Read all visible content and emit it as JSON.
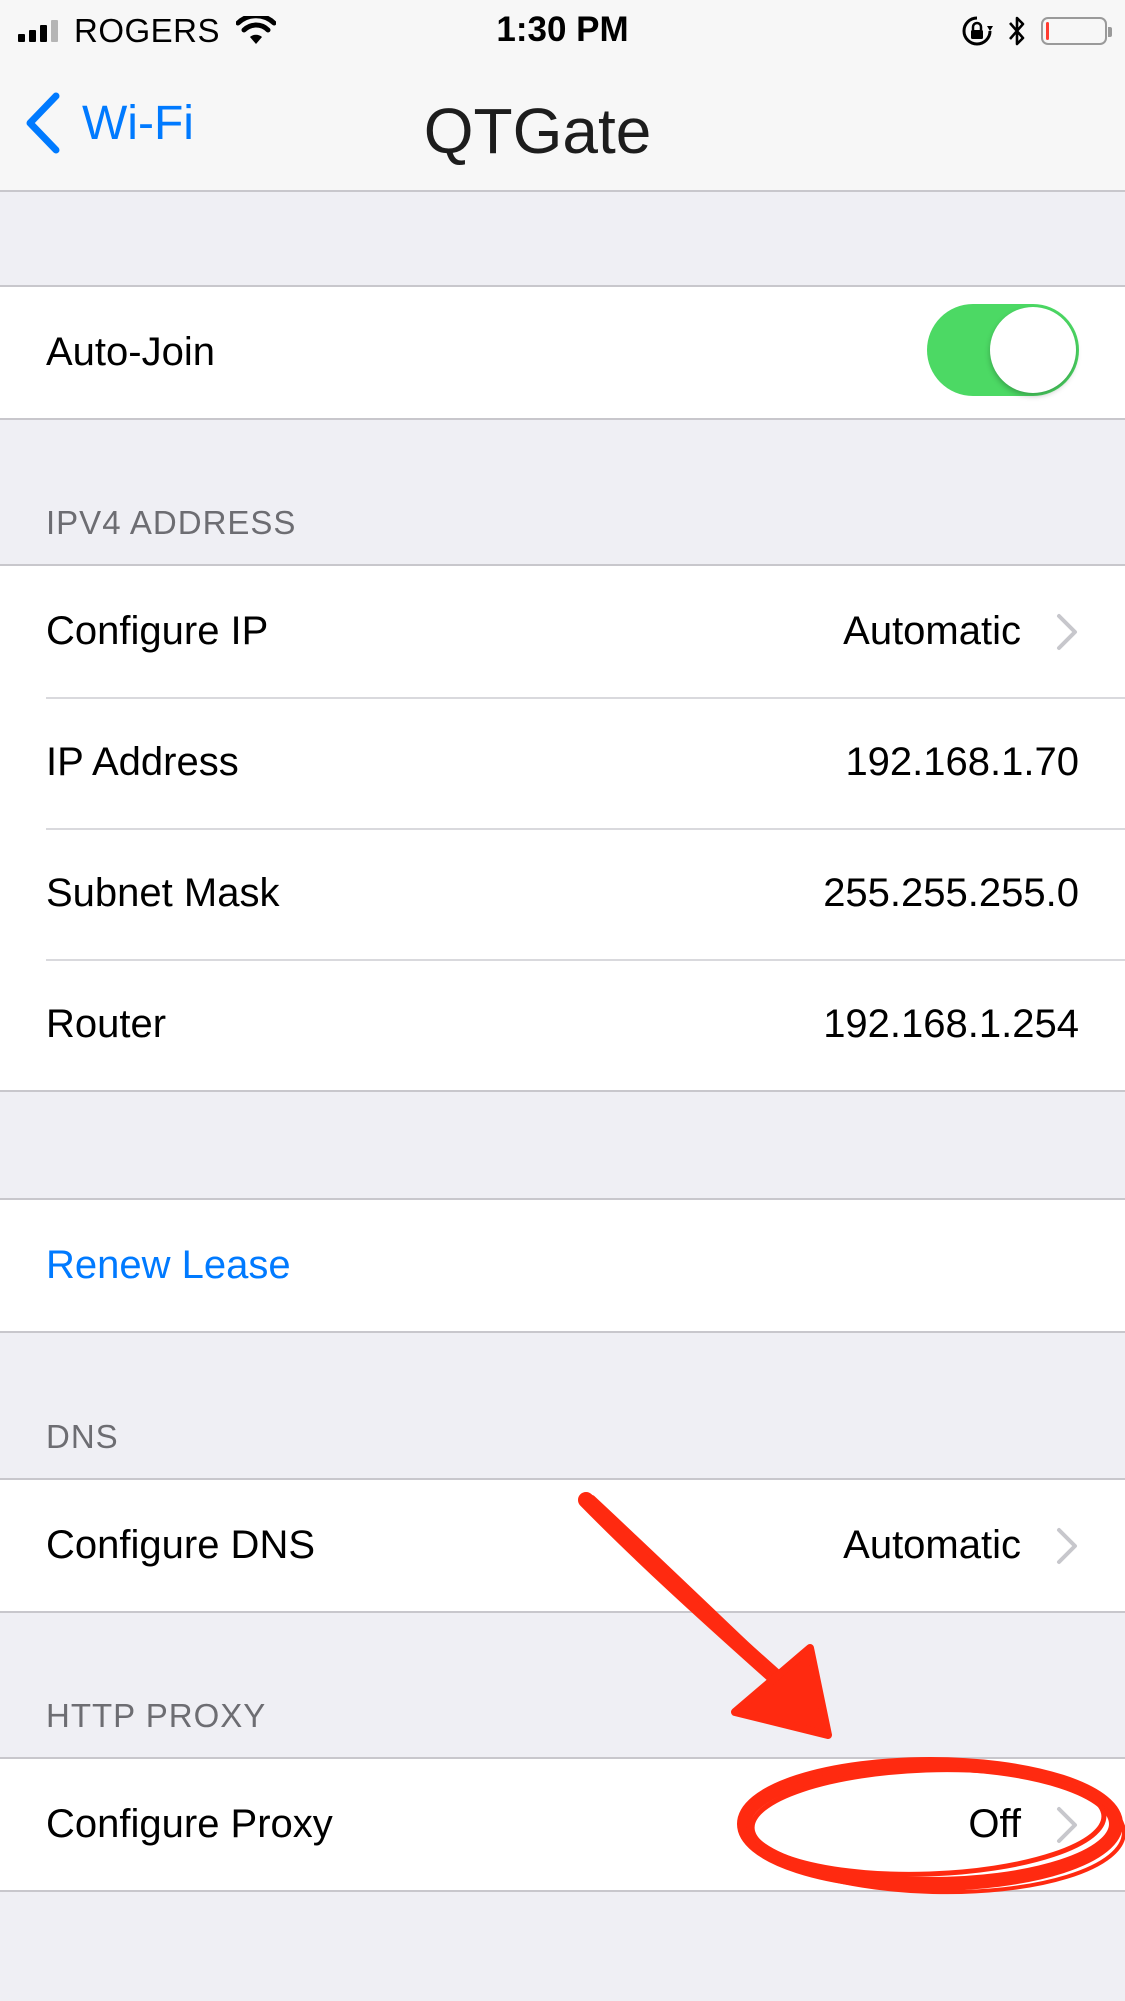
{
  "status_bar": {
    "carrier": "ROGERS",
    "time": "1:30 PM",
    "icons": [
      "signal-icon",
      "wifi-icon",
      "orientation-lock-icon",
      "bluetooth-icon",
      "battery-icon"
    ],
    "battery_level": 0.05,
    "battery_color": "#ff3b30"
  },
  "nav": {
    "back_label": "Wi-Fi",
    "title": "QTGate"
  },
  "auto_join": {
    "label": "Auto-Join",
    "enabled": true,
    "toggle_color": "#4cd964"
  },
  "ipv4": {
    "header": "IPV4 ADDRESS",
    "rows": [
      {
        "label": "Configure IP",
        "value": "Automatic"
      },
      {
        "label": "IP Address",
        "value": "192.168.1.70"
      },
      {
        "label": "Subnet Mask",
        "value": "255.255.255.0"
      },
      {
        "label": "Router",
        "value": "192.168.1.254"
      }
    ]
  },
  "renew": {
    "label": "Renew Lease"
  },
  "dns": {
    "header": "DNS",
    "rows": [
      {
        "label": "Configure DNS",
        "value": "Automatic"
      }
    ]
  },
  "proxy": {
    "header": "HTTP PROXY",
    "rows": [
      {
        "label": "Configure Proxy",
        "value": "Off"
      }
    ]
  },
  "colors": {
    "accent": "#007aff",
    "background": "#efeff4",
    "annotation": "#ff2a10"
  }
}
